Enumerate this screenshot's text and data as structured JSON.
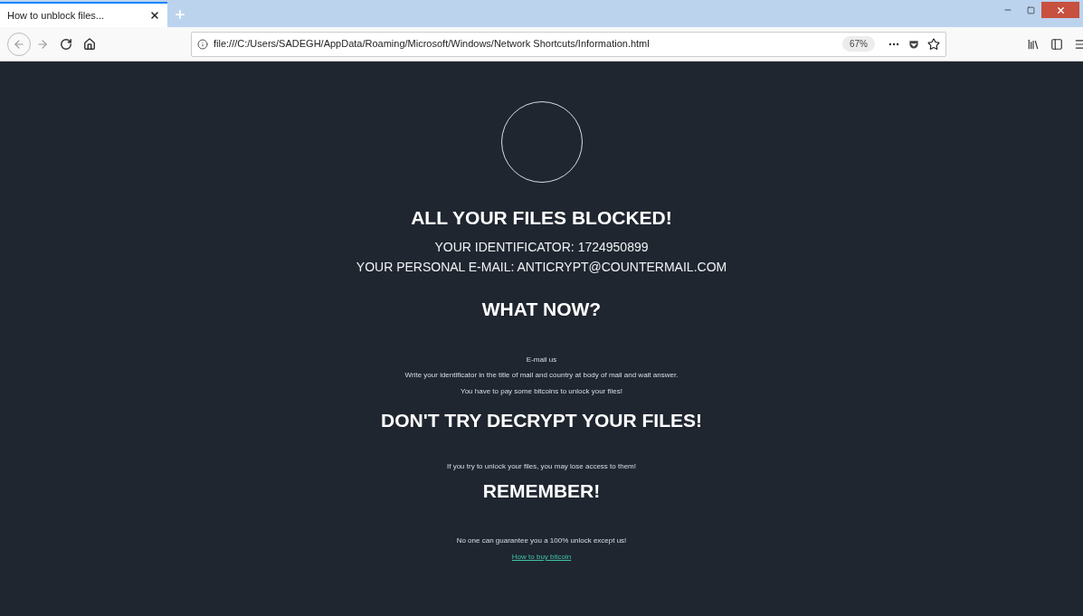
{
  "browser": {
    "tabs": [
      {
        "title": "How to unblock files...",
        "selected": true
      }
    ],
    "address": {
      "url": "file:///C:/Users/SADEGH/AppData/Roaming/Microsoft/Windows/Network Shortcuts/Information.html",
      "zoom": "67%"
    }
  },
  "page": {
    "blocks": [
      {
        "kind": "circle"
      },
      {
        "kind": "heading",
        "text": "ALL YOUR FILES BLOCKED!"
      },
      {
        "kind": "line",
        "text": "YOUR IDENTIFICATOR: 1724950899"
      },
      {
        "kind": "line",
        "text": "YOUR PERSONAL E-MAIL: ANTICRYPT@COUNTERMAIL.COM"
      },
      {
        "kind": "heading",
        "text": "WHAT NOW?"
      },
      {
        "kind": "small",
        "text": "E-mail us"
      },
      {
        "kind": "small",
        "text": "Write your identificator in the title of mail and country at body of mail and wait answer."
      },
      {
        "kind": "small",
        "text": "You have to pay some bitcoins to unlock your files!"
      },
      {
        "kind": "heading",
        "text": "DON'T TRY DECRYPT YOUR FILES!"
      },
      {
        "kind": "small",
        "text": "If you try to unlock your files, you may lose access to them!"
      },
      {
        "kind": "heading",
        "text": "REMEMBER!"
      },
      {
        "kind": "small",
        "text": "No one can guarantee you a 100% unlock except us!"
      },
      {
        "kind": "link",
        "text": "How to buy bitcoin"
      }
    ]
  }
}
